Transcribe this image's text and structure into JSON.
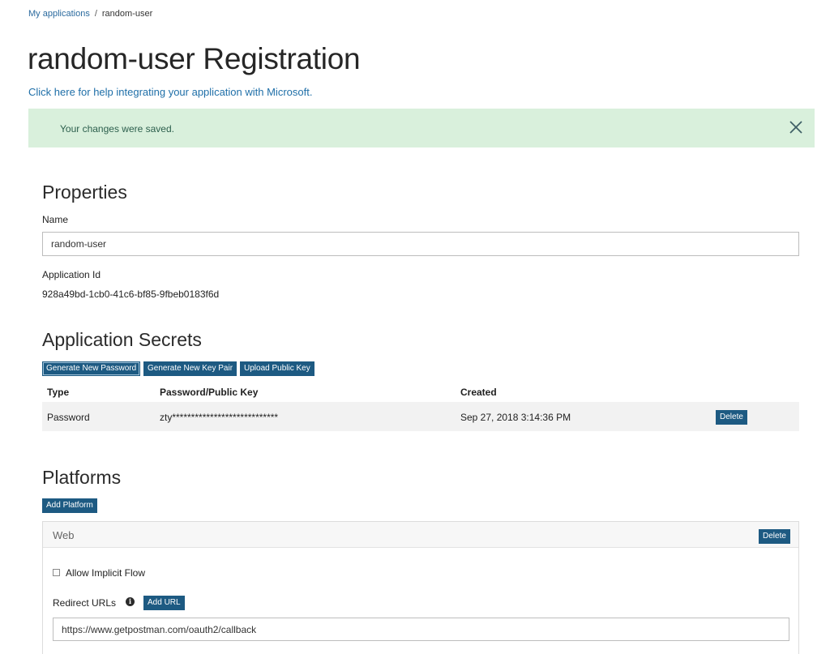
{
  "breadcrumb": {
    "parent": "My applications",
    "separator": "/",
    "current": "random-user"
  },
  "page": {
    "title": "random-user Registration",
    "help_link": "Click here for help integrating your application with Microsoft."
  },
  "banner": {
    "message": "Your changes were saved.",
    "close_icon": "close-icon",
    "background": "#d9f0dc"
  },
  "properties": {
    "heading": "Properties",
    "name_label": "Name",
    "name_value": "random-user",
    "app_id_label": "Application Id",
    "app_id_value": "928a49bd-1cb0-41c6-bf85-9fbeb0183f6d"
  },
  "secrets": {
    "heading": "Application Secrets",
    "buttons": {
      "generate_password": "Generate New Password",
      "generate_keypair": "Generate New Key Pair",
      "upload_key": "Upload Public Key"
    },
    "columns": [
      "Type",
      "Password/Public Key",
      "Created"
    ],
    "rows": [
      {
        "type": "Password",
        "key": "zty****************************",
        "created": "Sep 27, 2018 3:14:36 PM",
        "action": "Delete"
      }
    ]
  },
  "platforms": {
    "heading": "Platforms",
    "add_button": "Add Platform",
    "web": {
      "title": "Web",
      "delete_button": "Delete",
      "implicit_flow_label": "Allow Implicit Flow",
      "implicit_flow_checked": false,
      "redirect_label": "Redirect URLs",
      "info_icon": "info-icon",
      "add_url_button": "Add URL",
      "redirect_url": "https://www.getpostman.com/oauth2/callback"
    }
  },
  "colors": {
    "accent_button": "#1d5a82",
    "link": "#1f6fa8"
  }
}
